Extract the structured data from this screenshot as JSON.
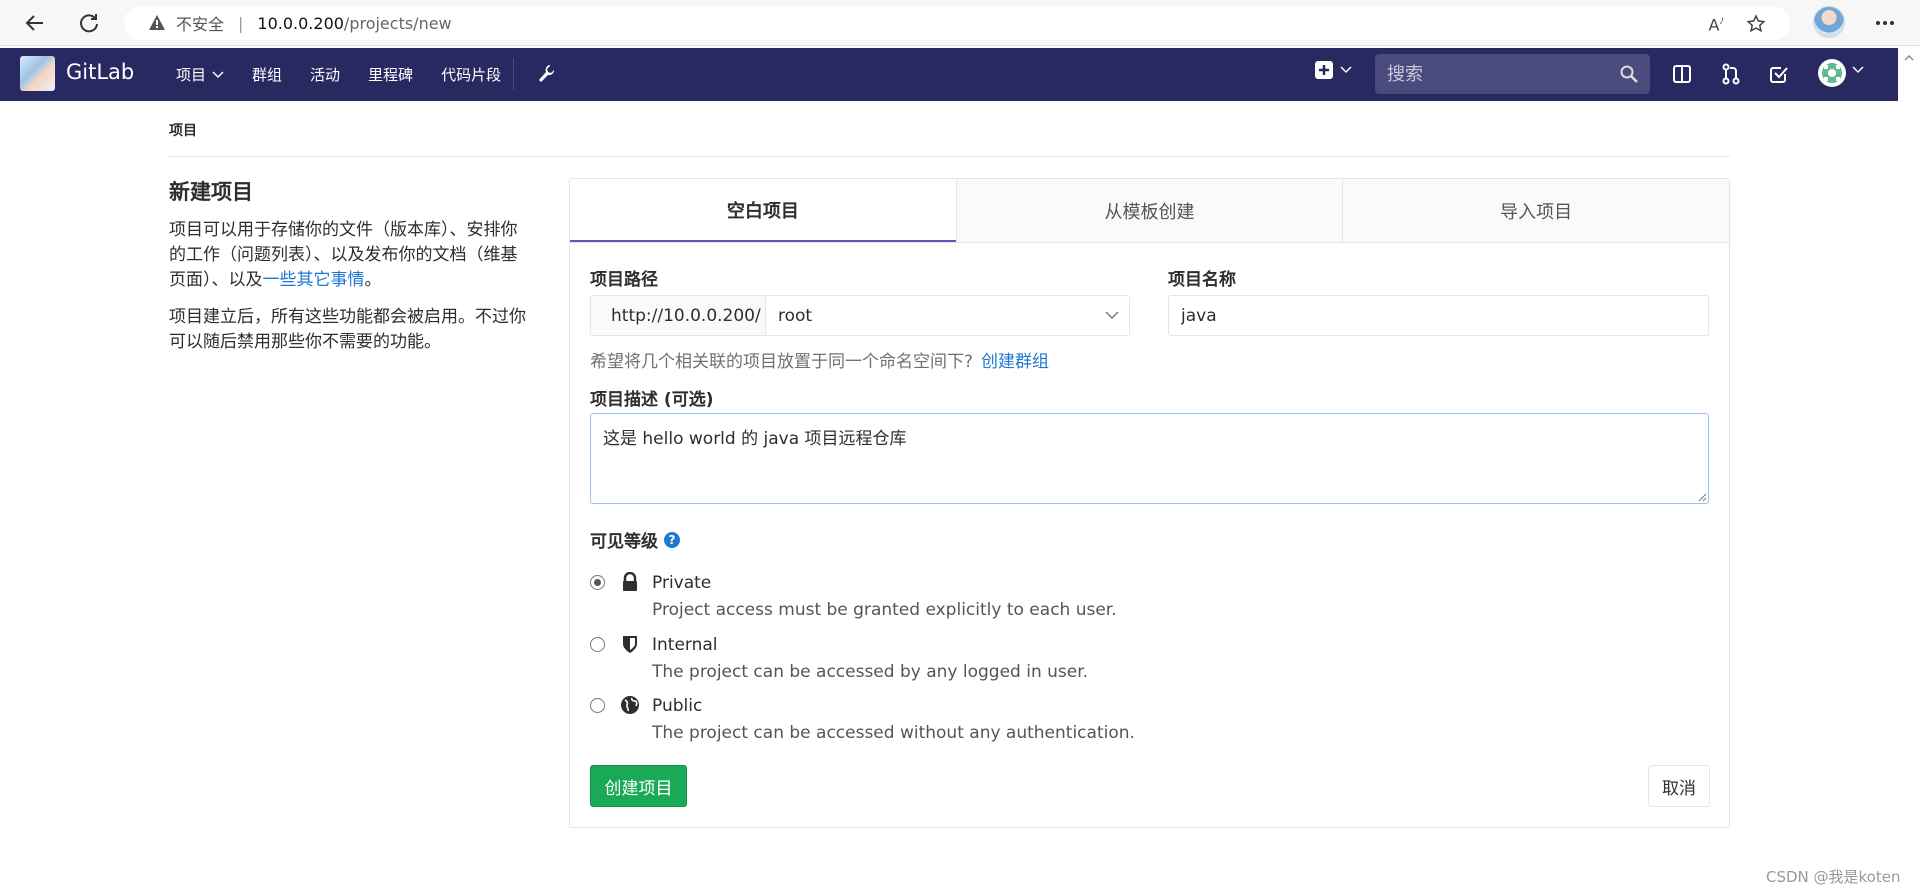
{
  "browser": {
    "security_label": "不安全",
    "url_host": "10.0.0.200",
    "url_path": "/projects/new"
  },
  "header": {
    "brand": "GitLab",
    "nav": [
      "项目",
      "群组",
      "活动",
      "里程碑",
      "代码片段"
    ],
    "search_placeholder": "搜索",
    "bg_color": "#292961"
  },
  "breadcrumb": "项目",
  "intro": {
    "title": "新建项目",
    "para1_text": "项目可以用于存储你的文件（版本库）、安排你的工作（问题列表）、以及发布你的文档（维基页面）、以及",
    "para1_link": "一些其它事情",
    "para1_end": "。",
    "para2": "项目建立后，所有这些功能都会被启用。不过你可以随后禁用那些你不需要的功能。"
  },
  "tabs": [
    "空白项目",
    "从模板创建",
    "导入项目"
  ],
  "form": {
    "path_label": "项目路径",
    "path_prefix": "http://10.0.0.200/",
    "namespace": "root",
    "name_label": "项目名称",
    "name_value": "java",
    "hint": "希望将几个相关联的项目放置于同一个命名空间下?",
    "hint_link": "创建群组",
    "desc_label": "项目描述 (可选)",
    "desc_value": "这是 hello world 的 java 项目远程仓库",
    "visibility_label": "可见等级",
    "visibility": [
      {
        "name": "Private",
        "desc": "Project access must be granted explicitly to each user.",
        "icon": "lock-icon",
        "checked": true
      },
      {
        "name": "Internal",
        "desc": "The project can be accessed by any logged in user.",
        "icon": "shield-icon",
        "checked": false
      },
      {
        "name": "Public",
        "desc": "The project can be accessed without any authentication.",
        "icon": "globe-icon",
        "checked": false
      }
    ],
    "create_label": "创建项目",
    "cancel_label": "取消"
  },
  "watermark": "CSDN @我是koten"
}
